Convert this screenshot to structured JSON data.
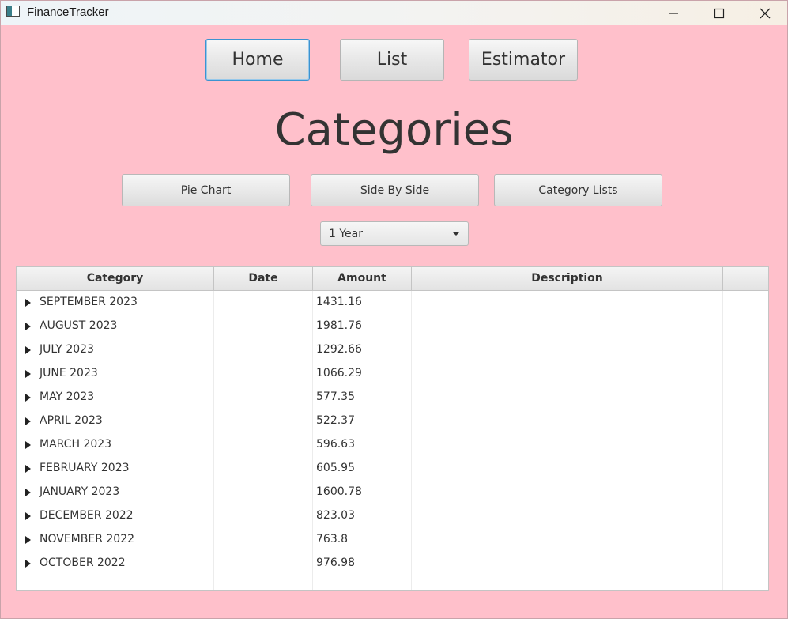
{
  "window": {
    "title": "FinanceTracker"
  },
  "nav": {
    "home": "Home",
    "list": "List",
    "estimator": "Estimator"
  },
  "page": {
    "title": "Categories"
  },
  "views": {
    "pie_chart": "Pie Chart",
    "side_by_side": "Side By Side",
    "category_lists": "Category Lists"
  },
  "period": {
    "selected": "1 Year"
  },
  "table": {
    "columns": [
      "Category",
      "Date",
      "Amount",
      "Description"
    ],
    "rows": [
      {
        "category": "SEPTEMBER 2023",
        "amount": "1431.16"
      },
      {
        "category": "AUGUST 2023",
        "amount": "1981.76"
      },
      {
        "category": "JULY 2023",
        "amount": "1292.66"
      },
      {
        "category": "JUNE 2023",
        "amount": "1066.29"
      },
      {
        "category": "MAY 2023",
        "amount": "577.35"
      },
      {
        "category": "APRIL 2023",
        "amount": "522.37"
      },
      {
        "category": "MARCH 2023",
        "amount": "596.63"
      },
      {
        "category": "FEBRUARY 2023",
        "amount": "605.95"
      },
      {
        "category": "JANUARY 2023",
        "amount": "1600.78"
      },
      {
        "category": "DECEMBER 2022",
        "amount": "823.03"
      },
      {
        "category": "NOVEMBER 2022",
        "amount": "763.8"
      },
      {
        "category": "OCTOBER 2022",
        "amount": "976.98"
      }
    ]
  },
  "icons": {
    "app": "app-window-icon",
    "minimize": "minimize-icon",
    "maximize": "maximize-icon",
    "close": "close-icon",
    "dropdown": "chevron-down-icon",
    "expand": "expand-triangle-icon"
  },
  "colors": {
    "background": "#ffc0cb",
    "focus": "#3c93d0"
  }
}
